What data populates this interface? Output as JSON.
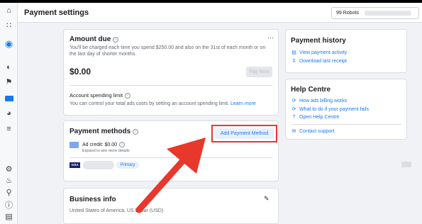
{
  "header": {
    "title": "Payment settings",
    "account_name": "99 Robots"
  },
  "amount_due": {
    "title": "Amount due",
    "description_line1": "You'll be charged each time you spend $250.00 and also on the 31st of each month or on",
    "description_line2": "the last day of shorter months.",
    "amount": "$0.00",
    "pay_now_label": "Pay Now",
    "spending_limit_title": "Account spending limit",
    "spending_limit_text": "You can control your total ads costs by setting an account spending limit.",
    "learn_more": "Learn more"
  },
  "payment_methods": {
    "title": "Payment methods",
    "add_button": "Add Payment Method",
    "ad_credit_label": "Ad credit: $0.00",
    "ad_credit_sub": "Expand to see more details",
    "card_brand": "VISA",
    "primary_badge": "Primary"
  },
  "business_info": {
    "title": "Business info",
    "text": "United States of America, US Dollar (USD)"
  },
  "payment_history": {
    "title": "Payment history",
    "links": [
      {
        "label": "View payment activity",
        "icon": "document-icon"
      },
      {
        "label": "Download last receipt",
        "icon": "download-icon"
      }
    ]
  },
  "help_centre": {
    "title": "Help Centre",
    "links": [
      {
        "label": "How ads billing works",
        "icon": "refresh-icon"
      },
      {
        "label": "What to do if your payment fails",
        "icon": "refresh-icon"
      },
      {
        "label": "Open Help Centre",
        "icon": "question-icon"
      }
    ],
    "contact": {
      "label": "Contact support",
      "icon": "mail-icon"
    }
  },
  "colors": {
    "accent": "#1877f2",
    "annotation": "#e8372b"
  }
}
